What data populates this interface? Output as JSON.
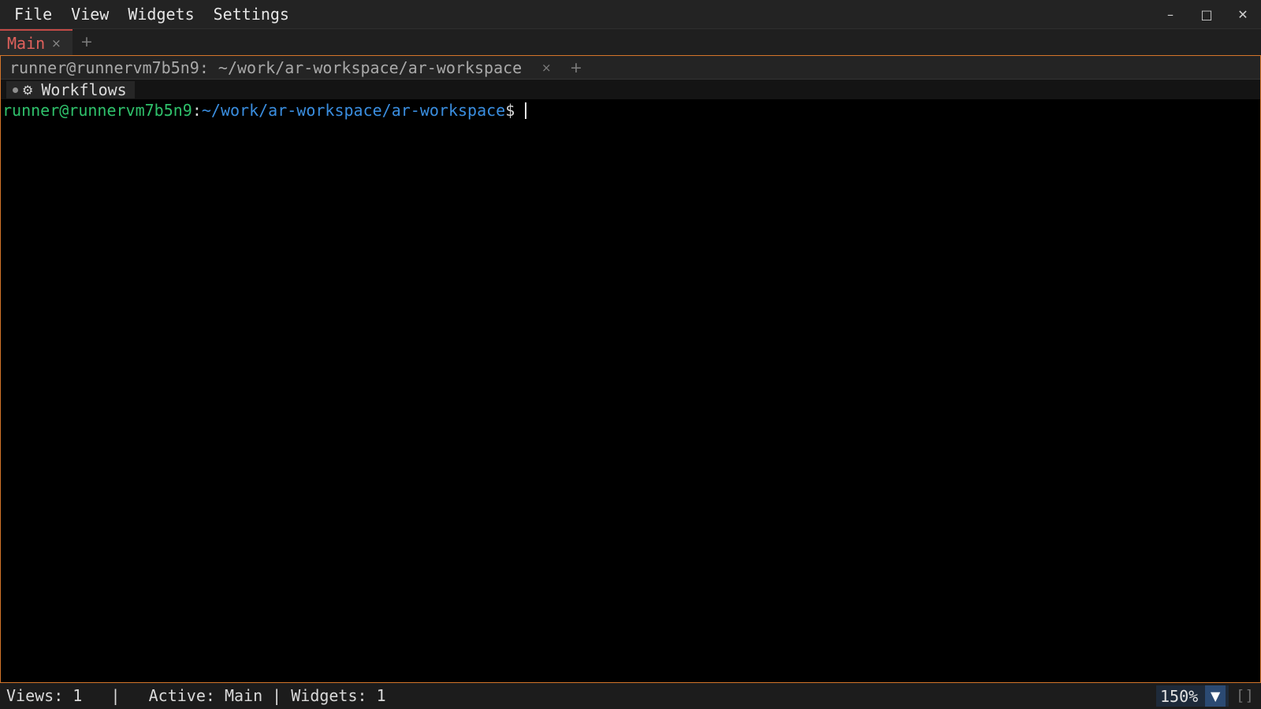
{
  "menubar": {
    "items": [
      "File",
      "View",
      "Widgets",
      "Settings"
    ],
    "window_controls": {
      "minimize": "–",
      "maximize": "□",
      "close": "✕"
    }
  },
  "tabs": {
    "main_label": "Main",
    "close_glyph": "×",
    "add_glyph": "+"
  },
  "pane": {
    "tab_title": "runner@runnervm7b5n9: ~/work/ar-workspace/ar-workspace",
    "tab_close_glyph": "×",
    "tab_add_glyph": "+",
    "workflows_label": "Workflows",
    "gear_glyph": "⚙"
  },
  "terminal": {
    "user_host": "runner@runnervm7b5n9",
    "colon": ":",
    "path": "~/work/ar-workspace/ar-workspace",
    "dollar": "$"
  },
  "status": {
    "text": "Views: 1   |   Active: Main | Widgets: 1",
    "zoom": "150%",
    "zoom_arrow": "▼",
    "bracket": "[]"
  },
  "colors": {
    "accent_orange": "#d4752a",
    "active_tab_red": "#e0615c",
    "prompt_green": "#2fc16b",
    "prompt_blue": "#3a8ee0"
  },
  "icons": {
    "gear": "gear-icon",
    "close": "close-icon",
    "add": "plus-icon",
    "dropdown": "chevron-down-icon"
  }
}
